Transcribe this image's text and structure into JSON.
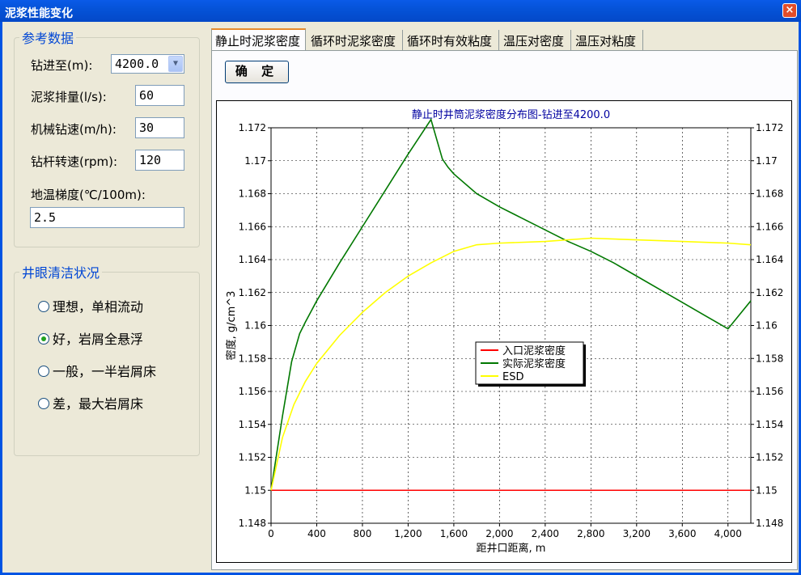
{
  "window": {
    "title": "泥浆性能变化",
    "close_label": "×"
  },
  "reference": {
    "legend": "参考数据",
    "depth_label": "钻进至(m):",
    "depth_value": "4200.0",
    "flow_label": "泥浆排量(l/s):",
    "flow_value": "60",
    "rop_label": "机械钻速(m/h):",
    "rop_value": "30",
    "rpm_label": "钻杆转速(rpm):",
    "rpm_value": "120",
    "geo_label": "地温梯度(℃/100m):",
    "geo_value": "2.5"
  },
  "cleaning": {
    "legend": "井眼清洁状况",
    "options": [
      {
        "label": "理想，单相流动",
        "selected": false
      },
      {
        "label": "好，岩屑全悬浮",
        "selected": true
      },
      {
        "label": "一般，一半岩屑床",
        "selected": false
      },
      {
        "label": "差，最大岩屑床",
        "selected": false
      }
    ]
  },
  "tabs": [
    {
      "label": "静止时泥浆密度",
      "active": true
    },
    {
      "label": "循环时泥浆密度",
      "active": false
    },
    {
      "label": "循环时有效粘度",
      "active": false
    },
    {
      "label": "温压对密度",
      "active": false
    },
    {
      "label": "温压对粘度",
      "active": false
    }
  ],
  "ok_button": "确 定",
  "chart_data": {
    "type": "line",
    "title": "静止时井筒泥浆密度分布图-钻进至4200.0",
    "xlabel": "距井口距离, m",
    "ylabel": "密度, g/cm^3",
    "xlim": [
      0,
      4200
    ],
    "ylim": [
      1.148,
      1.172
    ],
    "xticks": [
      "0",
      "400",
      "800",
      "1,200",
      "1,600",
      "2,000",
      "2,400",
      "2,800",
      "3,200",
      "3,600",
      "4,000"
    ],
    "yticks": [
      "1.148",
      "1.15",
      "1.152",
      "1.154",
      "1.156",
      "1.158",
      "1.16",
      "1.162",
      "1.164",
      "1.166",
      "1.168",
      "1.17",
      "1.172"
    ],
    "grid": true,
    "legend_position": "center",
    "series": [
      {
        "name": "入口泥浆密度",
        "color": "#ff0000",
        "x": [
          0,
          4200
        ],
        "y": [
          1.15,
          1.15
        ]
      },
      {
        "name": "实际泥浆密度",
        "color": "#007800",
        "x": [
          0,
          100,
          180,
          250,
          300,
          400,
          600,
          800,
          1000,
          1200,
          1400,
          1500,
          1550,
          1600,
          1800,
          2000,
          2200,
          2400,
          2600,
          2800,
          3000,
          3200,
          3400,
          3600,
          3800,
          4000,
          4200
        ],
        "y": [
          1.15,
          1.1545,
          1.1578,
          1.1595,
          1.1602,
          1.1615,
          1.1638,
          1.166,
          1.1682,
          1.1704,
          1.1725,
          1.1701,
          1.1696,
          1.1692,
          1.168,
          1.1672,
          1.1665,
          1.1658,
          1.1651,
          1.1645,
          1.1638,
          1.163,
          1.1622,
          1.1614,
          1.1606,
          1.1598,
          1.1615
        ]
      },
      {
        "name": "ESD",
        "color": "#ffff00",
        "x": [
          0,
          100,
          200,
          300,
          400,
          600,
          800,
          1000,
          1200,
          1400,
          1600,
          1800,
          2000,
          2400,
          2800,
          3200,
          3600,
          4000,
          4200
        ],
        "y": [
          1.15,
          1.1532,
          1.1552,
          1.1566,
          1.1577,
          1.1594,
          1.1608,
          1.162,
          1.163,
          1.1638,
          1.1645,
          1.1649,
          1.165,
          1.1651,
          1.1653,
          1.1652,
          1.1651,
          1.165,
          1.1649
        ]
      }
    ]
  }
}
